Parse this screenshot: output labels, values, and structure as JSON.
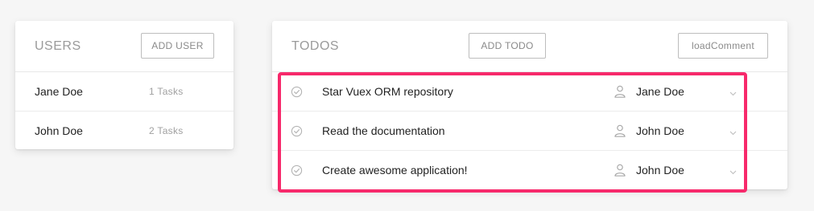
{
  "users": {
    "title": "USERS",
    "add_button": "ADD USER",
    "rows": [
      {
        "name": "Jane Doe",
        "tasks": "1 Tasks"
      },
      {
        "name": "John Doe",
        "tasks": "2 Tasks"
      }
    ]
  },
  "todos": {
    "title": "TODOS",
    "add_button": "ADD TODO",
    "load_button": "loadComment",
    "rows": [
      {
        "title": "Star Vuex ORM repository",
        "assignee": "Jane Doe"
      },
      {
        "title": "Read the documentation",
        "assignee": "John Doe"
      },
      {
        "title": "Create awesome application!",
        "assignee": "John Doe"
      }
    ]
  },
  "icons": {
    "check": "check-circle-icon",
    "person": "person-icon",
    "chevron": "chevron-down-icon"
  },
  "colors": {
    "highlight": "#f7296b",
    "background": "#f6f6f6",
    "muted_text": "#9a9a9a"
  }
}
